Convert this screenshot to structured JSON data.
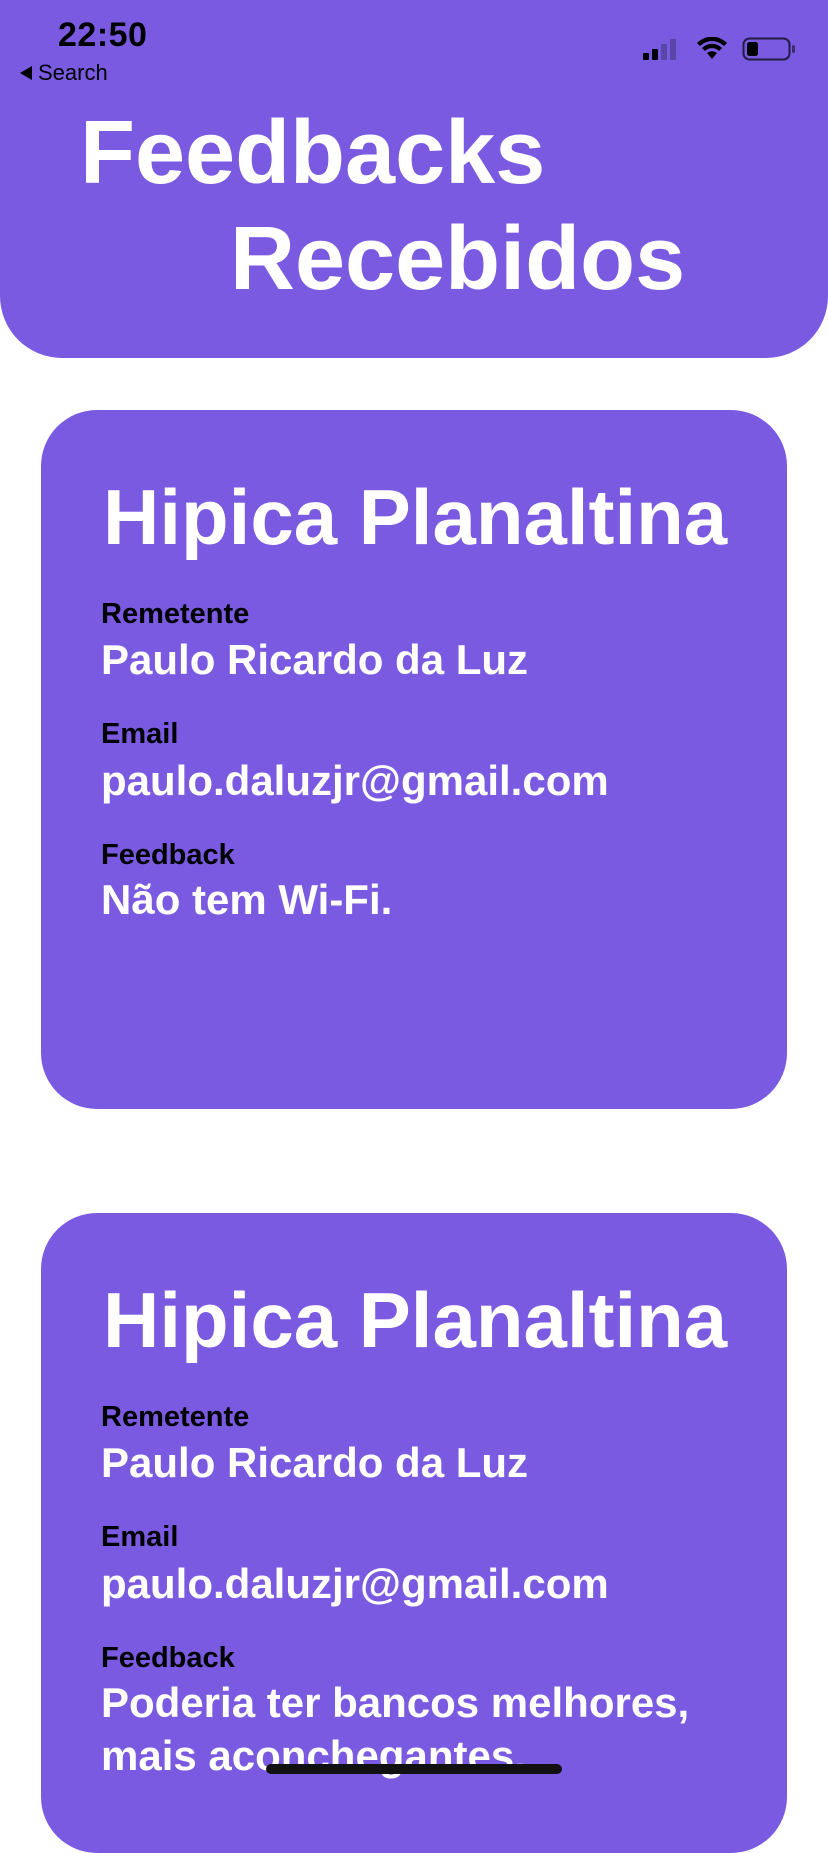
{
  "status_bar": {
    "time": "22:50",
    "back_label": "Search"
  },
  "header": {
    "title_line1": "Feedbacks",
    "title_line2": "Recebidos"
  },
  "feedbacks": [
    {
      "place": "Hipica Planaltina",
      "sender_label": "Remetente",
      "sender": "Paulo Ricardo da Luz",
      "email_label": "Email",
      "email": "paulo.daluzjr@gmail.com",
      "feedback_label": "Feedback",
      "feedback": "Não tem Wi-Fi."
    },
    {
      "place": "Hipica Planaltina",
      "sender_label": "Remetente",
      "sender": "Paulo Ricardo da Luz",
      "email_label": "Email",
      "email": "paulo.daluzjr@gmail.com",
      "feedback_label": "Feedback",
      "feedback": "Poderia ter bancos melhores, mais aconchegantes."
    }
  ],
  "colors": {
    "accent": "#7a5ae0",
    "background": "#ffffff"
  }
}
